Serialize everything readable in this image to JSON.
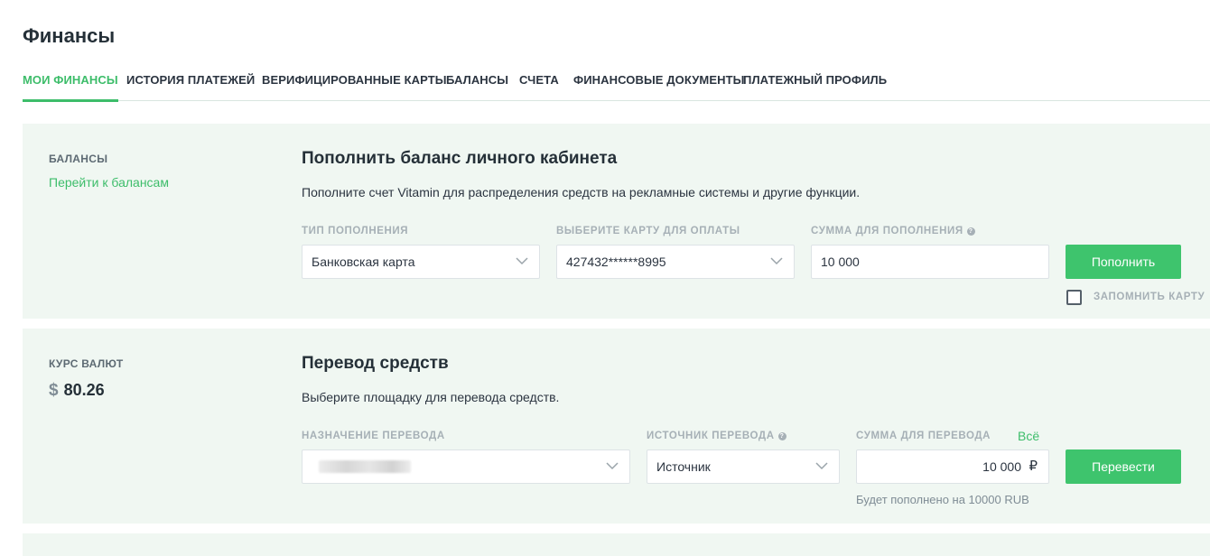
{
  "page_title": "Финансы",
  "tabs": [
    {
      "label": "МОИ ФИНАНСЫ",
      "active": true
    },
    {
      "label": "ИСТОРИЯ ПЛАТЕЖЕЙ"
    },
    {
      "label": "ВЕРИФИЦИРОВАННЫЕ КАРТЫ"
    },
    {
      "label": "БАЛАНСЫ"
    },
    {
      "label": "СЧЕТА"
    },
    {
      "label": "ФИНАНСОВЫЕ ДОКУМЕНТЫ"
    },
    {
      "label": "ПЛАТЕЖНЫЙ ПРОФИЛЬ"
    }
  ],
  "balances_card": {
    "side_label": "БАЛАНСЫ",
    "side_link": "Перейти к балансам",
    "title": "Пополнить баланс личного кабинета",
    "description": "Пополните счет Vitamin для распределения средств на рекламные системы и другие функции.",
    "type_label": "ТИП ПОПОЛНЕНИЯ",
    "type_value": "Банковская карта",
    "card_label": "ВЫБЕРИТЕ КАРТУ ДЛЯ ОПЛАТЫ",
    "card_value": "427432******8995",
    "amount_label": "СУММА ДЛЯ ПОПОЛНЕНИЯ",
    "amount_value": "10 000",
    "submit_label": "Пополнить",
    "remember_label": "ЗАПОМНИТЬ КАРТУ",
    "remember_checked": false
  },
  "transfer_card": {
    "side_label": "КУРС ВАЛЮТ",
    "currency_symbol": "$",
    "rate": "80.26",
    "title": "Перевод средств",
    "description": "Выберите площадку для перевода средств.",
    "destination_label": "НАЗНАЧЕНИЕ ПЕРЕВОДА",
    "source_label": "ИСТОЧНИК ПЕРЕВОДА",
    "source_value": "Источник",
    "amount_label": "СУММА ДЛЯ ПЕРЕВОДА",
    "all_link": "Всё",
    "amount_value": "10 000",
    "ruble_sign": "₽",
    "submit_label": "Перевести",
    "hint": "Будет пополнено на 10000 RUB"
  },
  "colors": {
    "accent": "#3dbd6a",
    "card_bg": "#f0f7f2",
    "title": "#253038",
    "muted_label": "#a6b0b6"
  },
  "icons": {
    "select_arrow": "chevron-down-icon",
    "help": "help-circle-icon"
  }
}
